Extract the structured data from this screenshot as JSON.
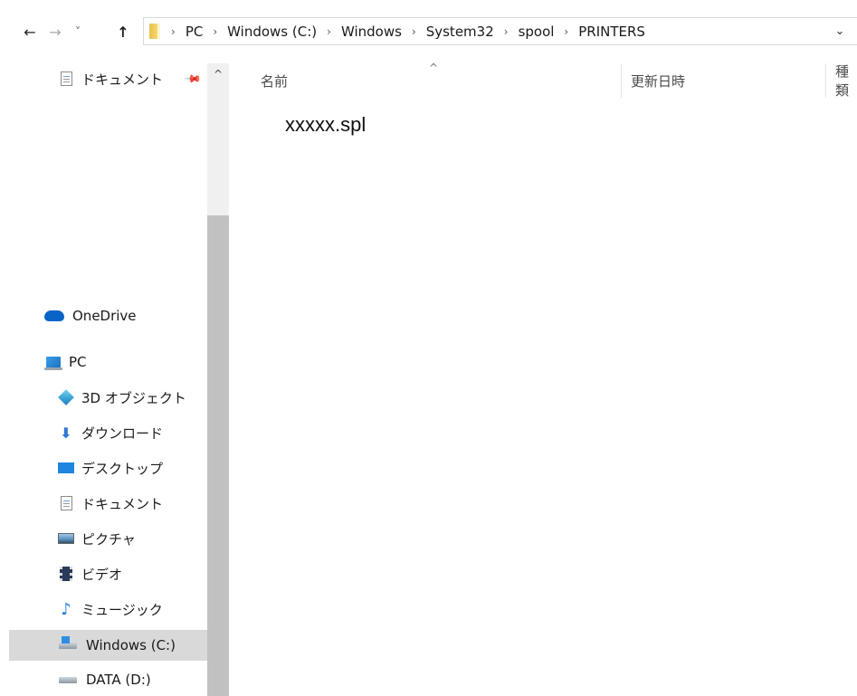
{
  "address": {
    "back_glyph": "←",
    "forward_glyph": "→",
    "recent_glyph": "˅",
    "up_glyph": "↑",
    "crumbs": [
      "PC",
      "Windows (C:)",
      "Windows",
      "System32",
      "spool",
      "PRINTERS"
    ],
    "sep_glyph": "›",
    "dropdown_glyph": "⌄"
  },
  "nav": {
    "quick_documents": "ドキュメント",
    "onedrive": "OneDrive",
    "pc": "PC",
    "objects3d": "3D オブジェクト",
    "downloads": "ダウンロード",
    "desktop": "デスクトップ",
    "documents": "ドキュメント",
    "pictures": "ピクチャ",
    "videos": "ビデオ",
    "music": "ミュージック",
    "drive_c": "Windows (C:)",
    "drive_d": "DATA (D:)"
  },
  "columns": {
    "name": "名前",
    "modified": "更新日時",
    "type": "種類"
  },
  "files": [
    "xxxxx.spl"
  ],
  "icons": {
    "pin": "pin-icon",
    "scroll_up": "chevron-up-icon",
    "sort": "sort-caret-icon"
  }
}
